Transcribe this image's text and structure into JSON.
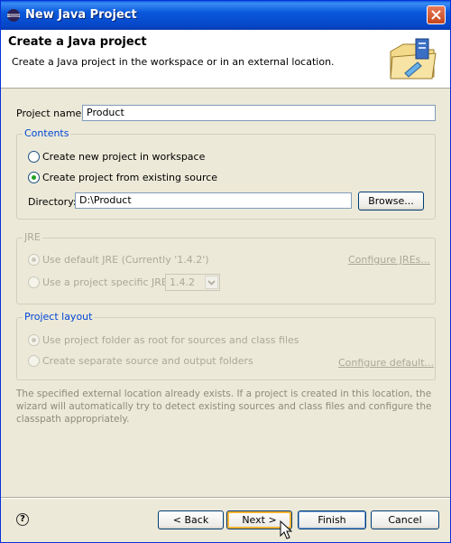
{
  "window": {
    "title": "New Java Project"
  },
  "header": {
    "title": "Create a Java project",
    "description": "Create a Java project in the workspace or in an external location."
  },
  "project_name": {
    "label": "Project name:",
    "value": "Product"
  },
  "contents": {
    "title": "Contents",
    "option_new": "Create new project in workspace",
    "option_existing": "Create project from existing source",
    "selected": "existing",
    "directory_label": "Directory:",
    "directory_value": "D:\\Product",
    "browse_label": "Browse..."
  },
  "jre": {
    "title": "JRE",
    "option_default": "Use default JRE (Currently '1.4.2')",
    "option_specific": "Use a project specific JRE:",
    "specific_value": "1.4.2",
    "configure_link": "Configure JREs..."
  },
  "layout": {
    "title": "Project layout",
    "option_root": "Use project folder as root for sources and class files",
    "option_separate": "Create separate source and output folders",
    "configure_link": "Configure default..."
  },
  "info_message": "The specified external location already exists. If a project is created in this location, the wizard will automatically try to detect existing sources and class files and configure the classpath appropriately.",
  "buttons": {
    "back": "< Back",
    "next": "Next >",
    "finish": "Finish",
    "cancel": "Cancel"
  },
  "icons": {
    "window": "eclipse-icon",
    "header": "new-java-project-wizard-icon",
    "help": "help-icon"
  }
}
